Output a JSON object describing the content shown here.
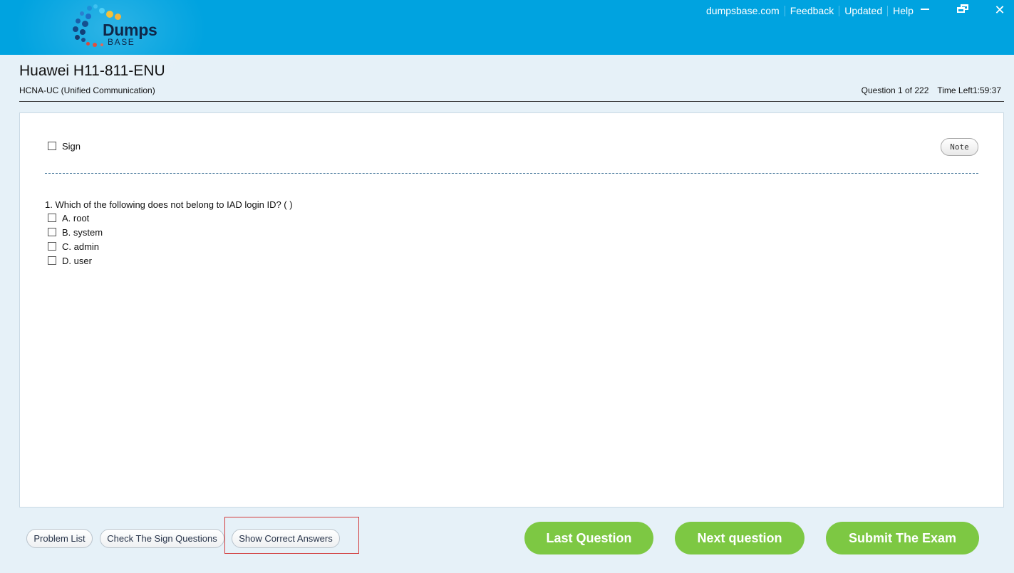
{
  "brand": {
    "logo_word": "Dumps",
    "logo_sub": "BASE"
  },
  "header": {
    "links": [
      "dumpsbase.com",
      "Feedback",
      "Updated",
      "Help"
    ],
    "window_controls": {
      "minimize_icon": "minimize-icon",
      "restore_icon": "restore-icon",
      "close_icon": "close-icon",
      "close_glyph": "✕"
    }
  },
  "exam": {
    "title": "Huawei H11-811-ENU",
    "subtitle": "HCNA-UC (Unified Communication)",
    "question_counter": "Question 1 of 222",
    "time_label": "Time Left",
    "time_value": "1:59:37"
  },
  "panel": {
    "sign_label": "Sign",
    "note_label": "Note",
    "question_text": "1. Which of the following does not belong to IAD login ID? ( )",
    "options": [
      "A. root",
      "B. system",
      "C. admin",
      "D. user"
    ]
  },
  "footer": {
    "problem_list": "Problem List",
    "check_sign": "Check The Sign Questions",
    "show_answers": "Show Correct Answers",
    "last_question": "Last Question",
    "next_question": "Next question",
    "submit": "Submit The Exam"
  },
  "colors": {
    "header_bg": "#00a3e0",
    "page_bg": "#e6f1f8",
    "green": "#7dc843",
    "highlight_red": "#d23b3b"
  }
}
